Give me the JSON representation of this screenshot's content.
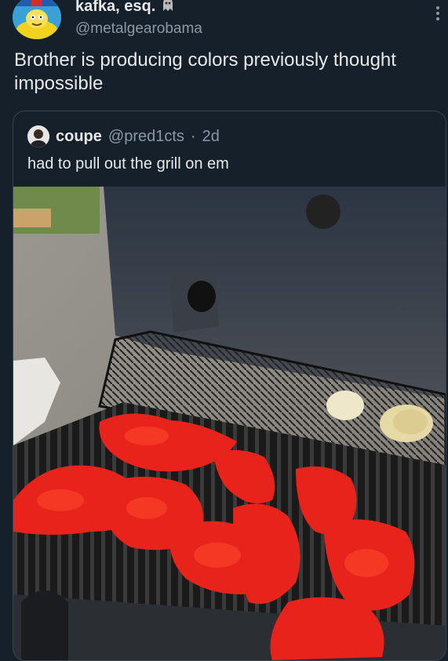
{
  "post": {
    "display_name": "kafka, esq.",
    "handle": "@metalgearobama",
    "text": "Brother is producing colors previously thought impossible"
  },
  "quoted": {
    "display_name": "coupe",
    "handle": "@pred1cts",
    "separator": "·",
    "time": "2d",
    "text": "had to pull out the grill on em"
  },
  "icons": {
    "more": "more-vertical-icon",
    "badge": "ghost-emoji-icon"
  },
  "colors": {
    "background": "#15202b",
    "text": "#e7e9ea",
    "muted": "#8b98a5",
    "border": "#38444d",
    "meat": "#e8231c"
  }
}
